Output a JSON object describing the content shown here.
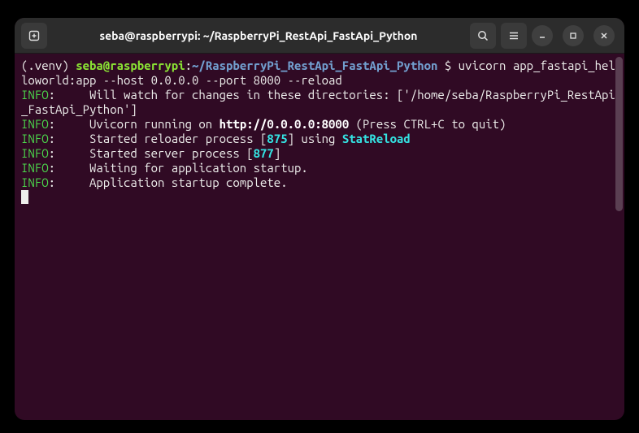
{
  "titlebar": {
    "title": "seba@raspberrypi: ~/RaspberryPi_RestApi_FastApi_Python"
  },
  "prompt": {
    "venv": "(.venv) ",
    "userhost": "seba@raspberrypi",
    "sep": ":",
    "path": "~/RaspberryPi_RestApi_FastApi_Python ",
    "dollar": "$ ",
    "command": "uvicorn app_fastapi_helloworld:app --host 0.0.0.0 --port 8000 --reload"
  },
  "lines": {
    "l1a": "INFO",
    "l1b": ":     Will watch for changes in these directories: ['/home/seba/RaspberryPi_RestApi_FastApi_Python']",
    "l2a": "INFO",
    "l2b": ":     Uvicorn running on ",
    "l2c": "http://0.0.0.0:8000",
    "l2d": " (Press CTRL+C to quit)",
    "l3a": "INFO",
    "l3b": ":     Started reloader process [",
    "l3c": "875",
    "l3d": "] using ",
    "l3e": "StatReload",
    "l4a": "INFO",
    "l4b": ":     Started server process [",
    "l4c": "877",
    "l4d": "]",
    "l5a": "INFO",
    "l5b": ":     Waiting for application startup.",
    "l6a": "INFO",
    "l6b": ":     Application startup complete."
  }
}
